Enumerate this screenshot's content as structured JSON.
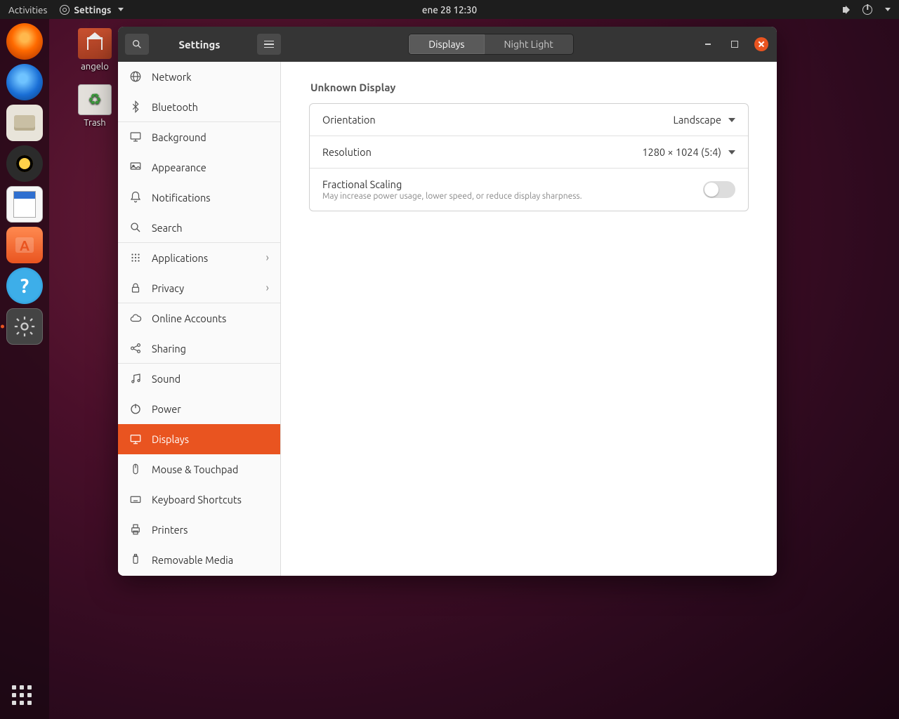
{
  "topbar": {
    "activities": "Activities",
    "app_label": "Settings",
    "clock": "ene 28  12:30"
  },
  "desktop": {
    "home_label": "angelo",
    "trash_label": "Trash"
  },
  "window": {
    "title": "Settings",
    "tabs": {
      "displays": "Displays",
      "night": "Night Light"
    }
  },
  "sidebar": [
    {
      "key": "network",
      "label": "Network",
      "icon": "globe"
    },
    {
      "key": "bluetooth",
      "label": "Bluetooth",
      "icon": "bluetooth",
      "divider": true
    },
    {
      "key": "background",
      "label": "Background",
      "icon": "desktop"
    },
    {
      "key": "appearance",
      "label": "Appearance",
      "icon": "appearance"
    },
    {
      "key": "notifications",
      "label": "Notifications",
      "icon": "bell"
    },
    {
      "key": "search",
      "label": "Search",
      "icon": "search",
      "divider": true
    },
    {
      "key": "applications",
      "label": "Applications",
      "icon": "grid",
      "chevron": true
    },
    {
      "key": "privacy",
      "label": "Privacy",
      "icon": "lock",
      "chevron": true,
      "divider": true
    },
    {
      "key": "online",
      "label": "Online Accounts",
      "icon": "cloud"
    },
    {
      "key": "sharing",
      "label": "Sharing",
      "icon": "share",
      "divider": true
    },
    {
      "key": "sound",
      "label": "Sound",
      "icon": "music"
    },
    {
      "key": "power",
      "label": "Power",
      "icon": "power"
    },
    {
      "key": "displays",
      "label": "Displays",
      "icon": "display",
      "active": true
    },
    {
      "key": "mouse",
      "label": "Mouse & Touchpad",
      "icon": "mouse"
    },
    {
      "key": "keyboard",
      "label": "Keyboard Shortcuts",
      "icon": "keyboard"
    },
    {
      "key": "printers",
      "label": "Printers",
      "icon": "printer"
    },
    {
      "key": "removable",
      "label": "Removable Media",
      "icon": "usb"
    }
  ],
  "content": {
    "heading": "Unknown Display",
    "orientation": {
      "label": "Orientation",
      "value": "Landscape"
    },
    "resolution": {
      "label": "Resolution",
      "value": "1280 × 1024 (5:4)"
    },
    "fractional": {
      "label": "Fractional Scaling",
      "sub": "May increase power usage, lower speed, or reduce display sharpness.",
      "enabled": false
    }
  }
}
